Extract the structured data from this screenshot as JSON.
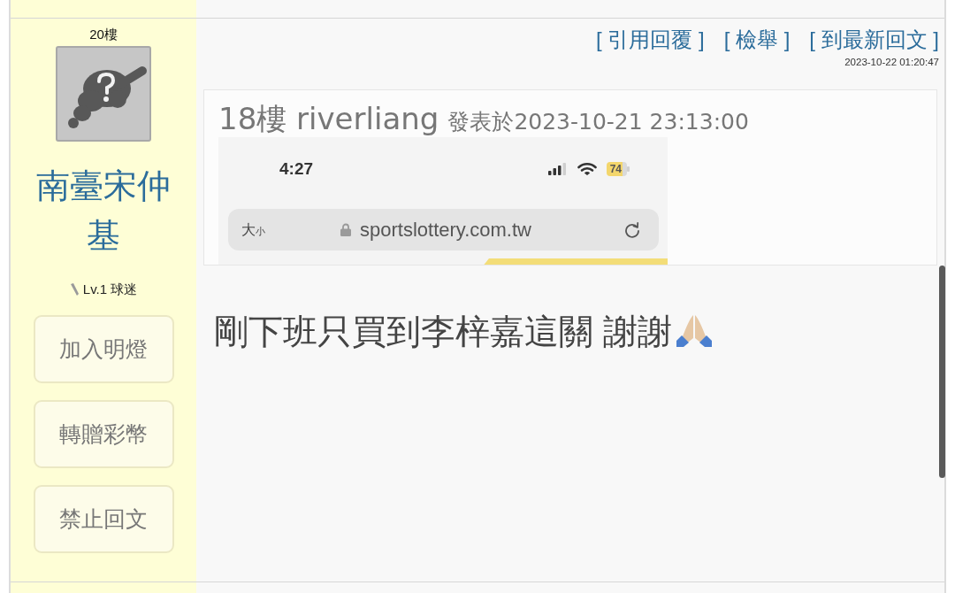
{
  "post": {
    "floor": "20樓",
    "author": {
      "name": "南臺宋仲基",
      "level": "Lv.1 球迷"
    },
    "actions": [
      {
        "label": "加入明燈"
      },
      {
        "label": "轉贈彩幣"
      },
      {
        "label": "禁止回文"
      }
    ],
    "links": [
      {
        "label": "[ 引用回覆 ]"
      },
      {
        "label": "[ 檢舉 ]"
      },
      {
        "label": "[ 到最新回文 ]"
      }
    ],
    "timestamp": "2023-10-22 01:20:47",
    "quote": {
      "title": "18樓 riverliang",
      "posted": "發表於2023-10-21 23:13:00",
      "screenshot": {
        "time": "4:27",
        "battery": "74",
        "text_size": "大$_{小}$",
        "url": "sportslottery.com.tw"
      }
    },
    "body": "剛下班只買到李梓嘉這關 謝謝"
  }
}
